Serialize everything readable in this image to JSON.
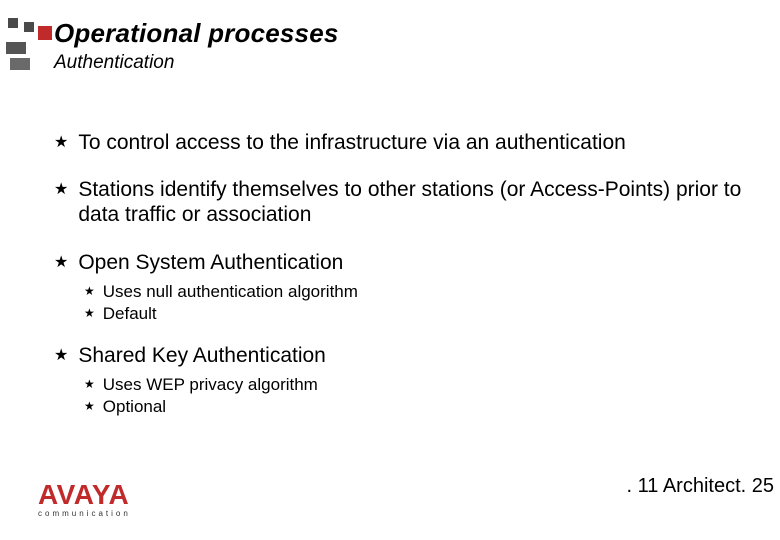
{
  "title": "Operational processes",
  "subtitle": "Authentication",
  "bullets": [
    {
      "text": "To control access to the infrastructure via an authentication"
    },
    {
      "text": "Stations identify themselves to other stations (or Access-Points) prior to data traffic or association"
    },
    {
      "text": "Open System Authentication",
      "sub": [
        "Uses null authentication algorithm",
        "Default"
      ]
    },
    {
      "text": "Shared Key Authentication",
      "sub": [
        "Uses WEP privacy algorithm",
        "Optional"
      ]
    }
  ],
  "footer": {
    "brand": "AVAYA",
    "brand_tag": "communication",
    "right": ". 11 Architect. 25"
  }
}
